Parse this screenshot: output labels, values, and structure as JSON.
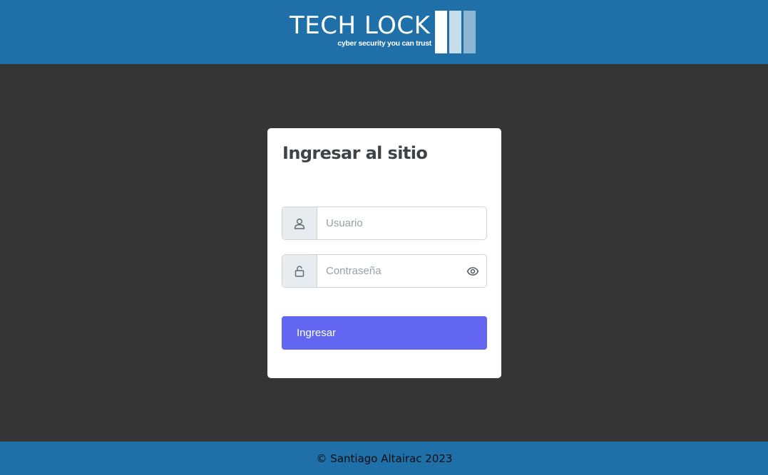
{
  "header": {
    "logo_title": "TECH LOCK",
    "logo_tagline": "cyber security you can trust"
  },
  "login": {
    "title": "Ingresar al sitio",
    "username_placeholder": "Usuario",
    "username_value": "",
    "password_placeholder": "Contraseña",
    "password_value": "",
    "submit_label": "Ingresar"
  },
  "icons": {
    "username": "user-icon",
    "password": "unlock-icon",
    "toggle_password": "eye-icon"
  },
  "colors": {
    "header_bg": "#1f6fa8",
    "page_bg": "#353535",
    "card_bg": "#ffffff",
    "accent": "#6366f1",
    "addon_bg": "#e9ecef"
  },
  "footer": {
    "copyright": "© Santiago Altairac 2023"
  }
}
